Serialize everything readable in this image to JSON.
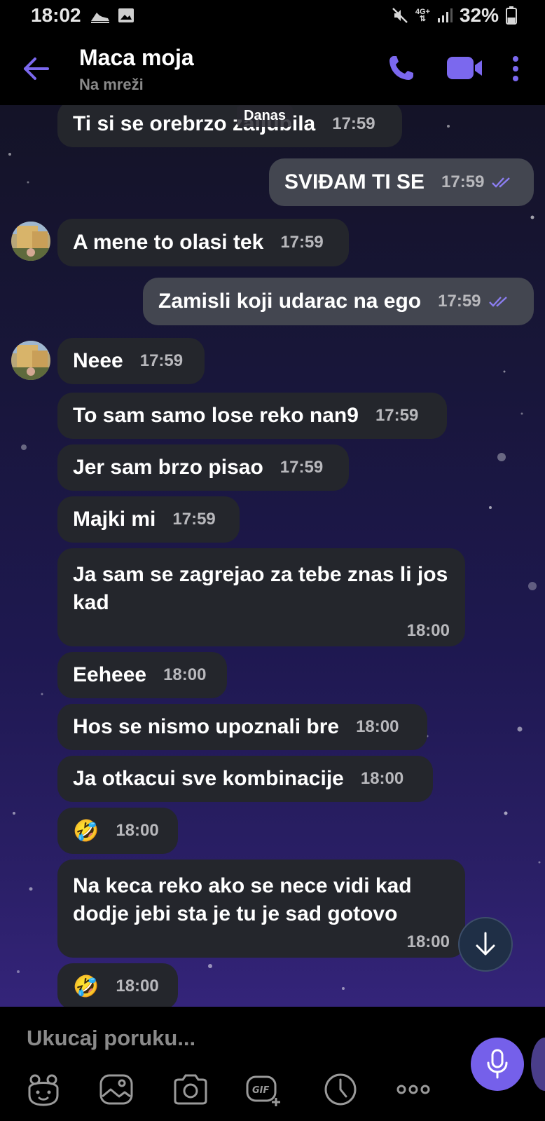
{
  "status_bar": {
    "time": "18:02",
    "network": "4G+",
    "battery": "32%"
  },
  "header": {
    "contact_name": "Maca moja",
    "contact_status": "Na mreži"
  },
  "chat": {
    "date_chip": "Danas",
    "messages": [
      {
        "direction": "in",
        "text": "Ti si se orebrzo zaljubila",
        "time": "17:59"
      },
      {
        "direction": "out",
        "text": "SVIĐAM TI SE",
        "time": "17:59"
      },
      {
        "direction": "in",
        "text": "A mene to olasi tek",
        "time": "17:59"
      },
      {
        "direction": "out",
        "text": "Zamisli koji udarac na ego",
        "time": "17:59"
      },
      {
        "direction": "in",
        "text": "Neee",
        "time": "17:59"
      },
      {
        "direction": "in",
        "text": "To sam samo lose reko nan9",
        "time": "17:59"
      },
      {
        "direction": "in",
        "text": "Jer sam brzo pisao",
        "time": "17:59"
      },
      {
        "direction": "in",
        "text": "Majki mi",
        "time": "17:59"
      },
      {
        "direction": "in",
        "text": "Ja sam se zagrejao za tebe znas li jos kad",
        "time": "18:00"
      },
      {
        "direction": "in",
        "text": "Eeheee",
        "time": "18:00"
      },
      {
        "direction": "in",
        "text": "Hos se nismo upoznali bre",
        "time": "18:00"
      },
      {
        "direction": "in",
        "text": "Ja otkacui sve kombinacije",
        "time": "18:00"
      },
      {
        "direction": "in",
        "text": "🤣",
        "time": "18:00"
      },
      {
        "direction": "in",
        "text": "Na keca reko ako se nece vidi kad dodje jebi sta je tu je sad gotovo",
        "time": "18:00"
      },
      {
        "direction": "in",
        "text": "🤣",
        "time": "18:00"
      }
    ]
  },
  "composer": {
    "placeholder": "Ukucaj poruku..."
  },
  "toolbar_icons": [
    "sticker-icon",
    "gallery-icon",
    "camera-icon",
    "gif-icon",
    "timer-icon",
    "more-options-icon"
  ],
  "colors": {
    "accent": "#7560ea",
    "incoming_bubble": "#24262c",
    "outgoing_bubble": "#434650",
    "read_ticks": "#8b7df0"
  }
}
